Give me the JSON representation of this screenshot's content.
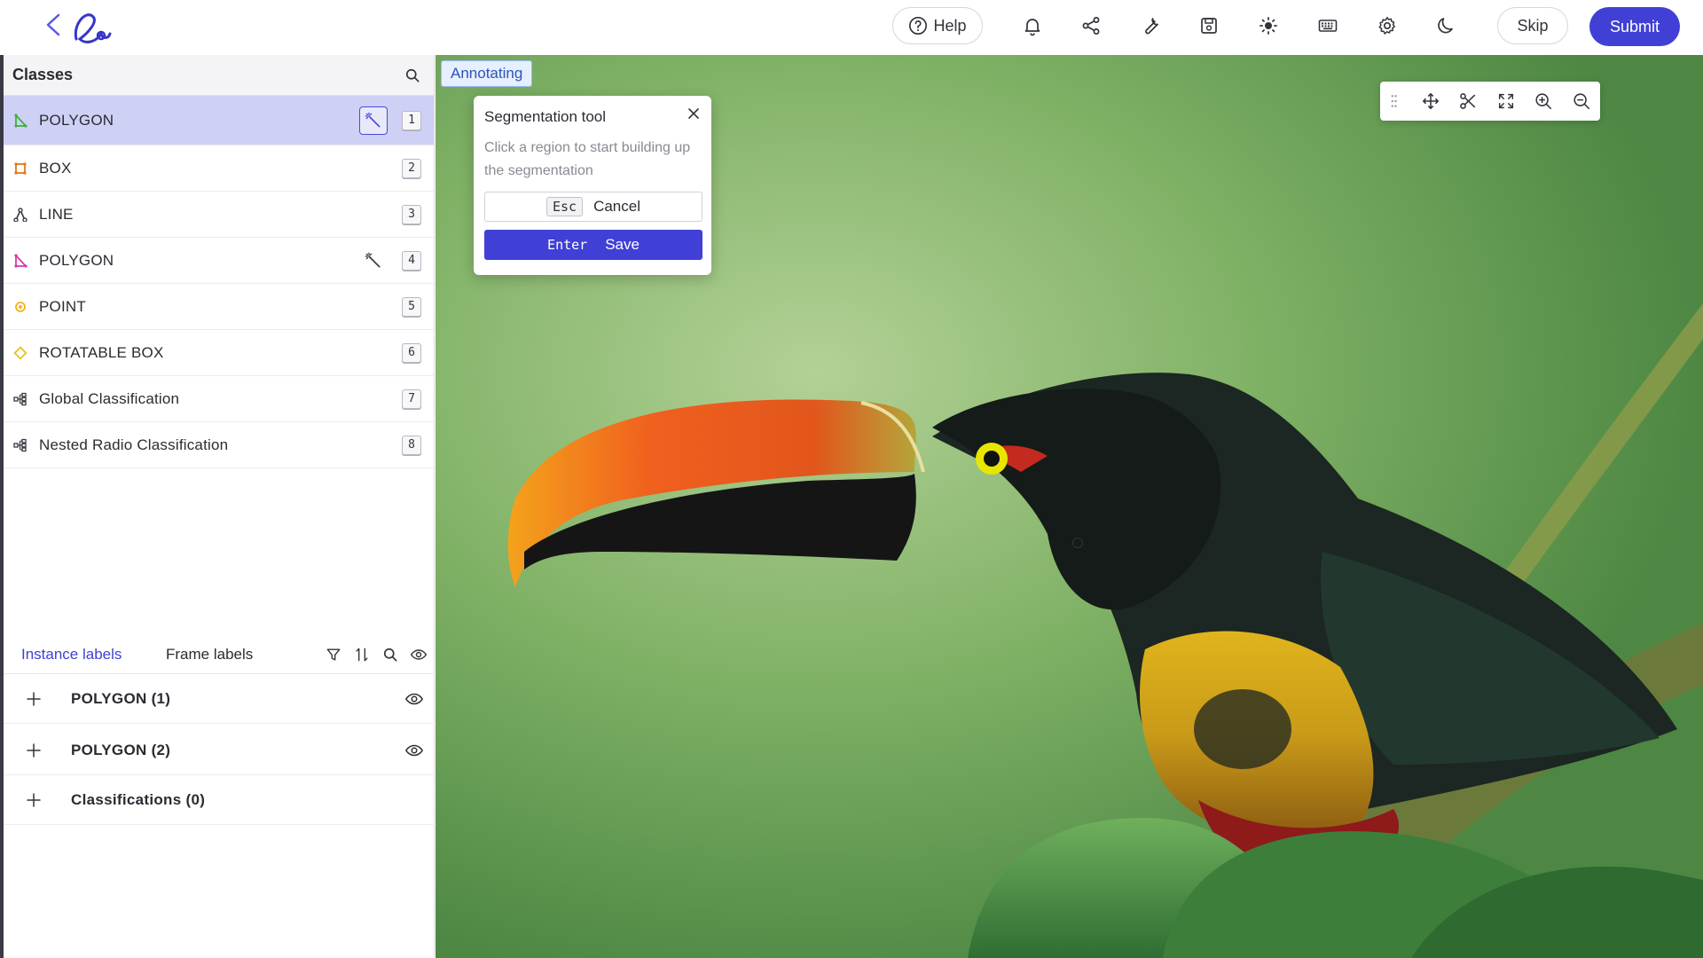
{
  "header": {
    "help_label": "Help",
    "skip_label": "Skip",
    "submit_label": "Submit",
    "icons": [
      "back-arrow-icon",
      "logo-icon",
      "help-icon",
      "bell-icon",
      "share-icon",
      "wrench-icon",
      "save-icon",
      "brightness-icon",
      "keyboard-icon",
      "gear-icon",
      "moon-icon"
    ]
  },
  "sidebar": {
    "title": "Classes",
    "classes": [
      {
        "label": "POLYGON",
        "hotkey": "1",
        "color": "#3fae3f",
        "icon": "polygon-icon",
        "selected": true,
        "wand": "active"
      },
      {
        "label": "BOX",
        "hotkey": "2",
        "color": "#e07a1f",
        "icon": "box-icon"
      },
      {
        "label": "LINE",
        "hotkey": "3",
        "color": "#3a3a44",
        "icon": "line-icon"
      },
      {
        "label": "POLYGON",
        "hotkey": "4",
        "color": "#d63aa8",
        "icon": "polygon-icon",
        "wand": "inactive"
      },
      {
        "label": "POINT",
        "hotkey": "5",
        "color": "#f2b21a",
        "icon": "point-icon"
      },
      {
        "label": "ROTATABLE BOX",
        "hotkey": "6",
        "color": "#e8c21a",
        "icon": "rotatable-box-icon"
      },
      {
        "label": "Global Classification",
        "hotkey": "7",
        "color": "#3a3a44",
        "icon": "classification-icon"
      },
      {
        "label": "Nested Radio Classification",
        "hotkey": "8",
        "color": "#3a3a44",
        "icon": "classification-icon"
      }
    ],
    "tabs": {
      "instance": "Instance labels",
      "frame": "Frame labels"
    },
    "instances": [
      {
        "label": "POLYGON (1)"
      },
      {
        "label": "POLYGON (2)"
      },
      {
        "label": "Classifications (0)"
      }
    ]
  },
  "canvas": {
    "status": "Annotating",
    "popup": {
      "title": "Segmentation tool",
      "description": "Click a region to start building up the segmentation",
      "cancel_key": "Esc",
      "cancel_label": "Cancel",
      "save_key": "Enter",
      "save_label": "Save"
    },
    "toolbar_icons": [
      "move-icon",
      "scissors-icon",
      "fit-screen-icon",
      "zoom-in-icon",
      "zoom-out-icon"
    ]
  },
  "colors": {
    "accent": "#4040d6",
    "selected_row": "#cfd0f5"
  }
}
